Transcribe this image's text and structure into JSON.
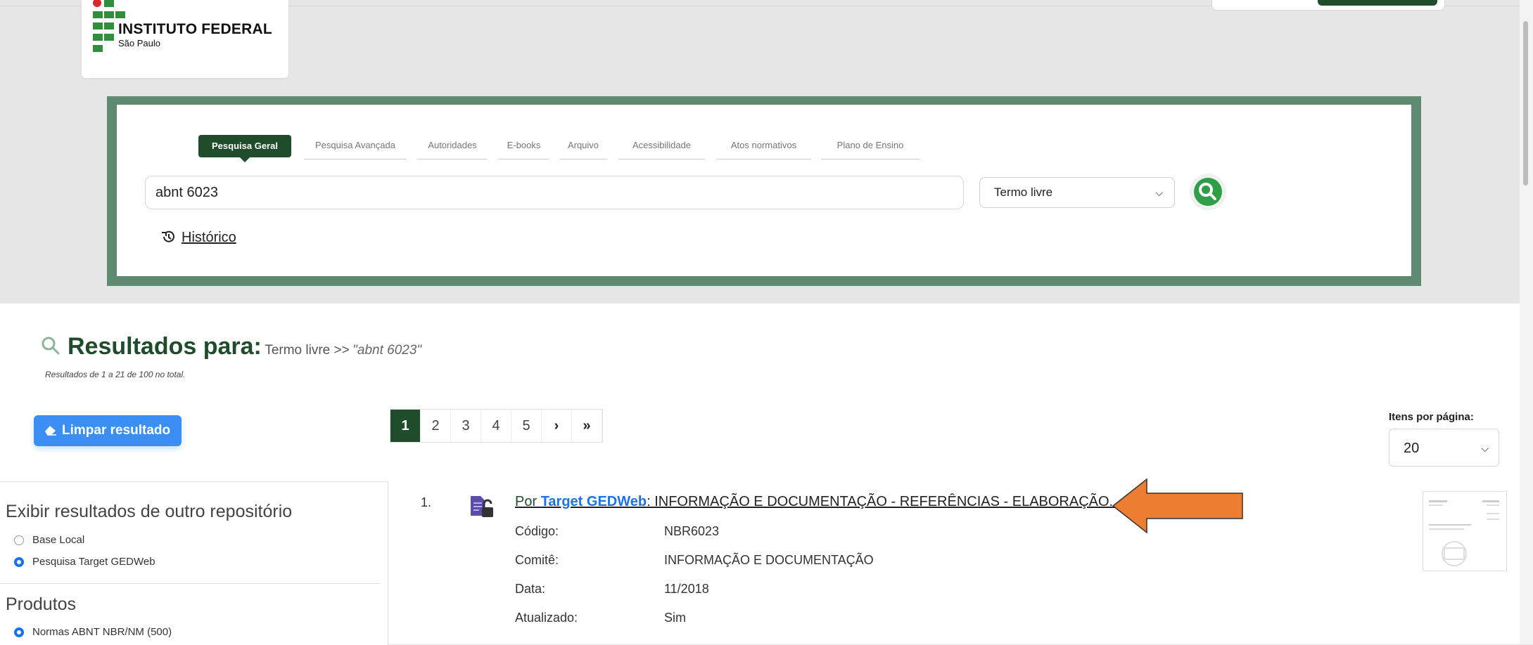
{
  "logo": {
    "title": "INSTITUTO FEDERAL",
    "subtitle": "São Paulo"
  },
  "search": {
    "tabs": [
      "Pesquisa Geral",
      "Pesquisa Avançada",
      "Autoridades",
      "E-books",
      "Arquivo",
      "Acessibilidade",
      "Atos normativos",
      "Plano de Ensino"
    ],
    "query": "abnt 6023",
    "filter_selected": "Termo livre",
    "history_label": "Histórico"
  },
  "results": {
    "title": "Resultados para:",
    "criteria_prefix": "Termo livre >>",
    "criteria_query": "\"abnt 6023\"",
    "count_text": "Resultados de 1 a 21 de 100 no total.",
    "clear_label": "Limpar resultado",
    "pages": [
      "1",
      "2",
      "3",
      "4",
      "5",
      "›",
      "»"
    ],
    "current_page": "1",
    "items_per_page_label": "Itens por página:",
    "items_per_page": "20"
  },
  "sidebar": {
    "repo_heading": "Exibir resultados de outro repositório",
    "repo_options": [
      {
        "label": "Base Local",
        "selected": false
      },
      {
        "label": "Pesquisa Target GEDWeb",
        "selected": true
      }
    ],
    "products_heading": "Produtos",
    "product_options": [
      {
        "label": "Normas ABNT NBR/NM (500)",
        "selected": true
      }
    ]
  },
  "result_item": {
    "index": "1.",
    "link_prefix": "Por ",
    "link_source": "Target GEDWeb",
    "link_title": ": INFORMAÇÃO E DOCUMENTAÇÃO - REFERÊNCIAS - ELABORAÇÃO...",
    "fields": [
      {
        "label": "Código:",
        "value": "NBR6023"
      },
      {
        "label": "Comitê:",
        "value": "INFORMAÇÃO E DOCUMENTAÇÃO"
      },
      {
        "label": "Data:",
        "value": "11/2018"
      },
      {
        "label": "Atualizado:",
        "value": "Sim"
      }
    ]
  },
  "colors": {
    "brand_green": "#1f4d2b",
    "icon_green": "#2f9e44",
    "frame_green": "#5f8a72",
    "button_blue": "#3b8ff2",
    "annotation_arrow": "#ed7d31"
  }
}
